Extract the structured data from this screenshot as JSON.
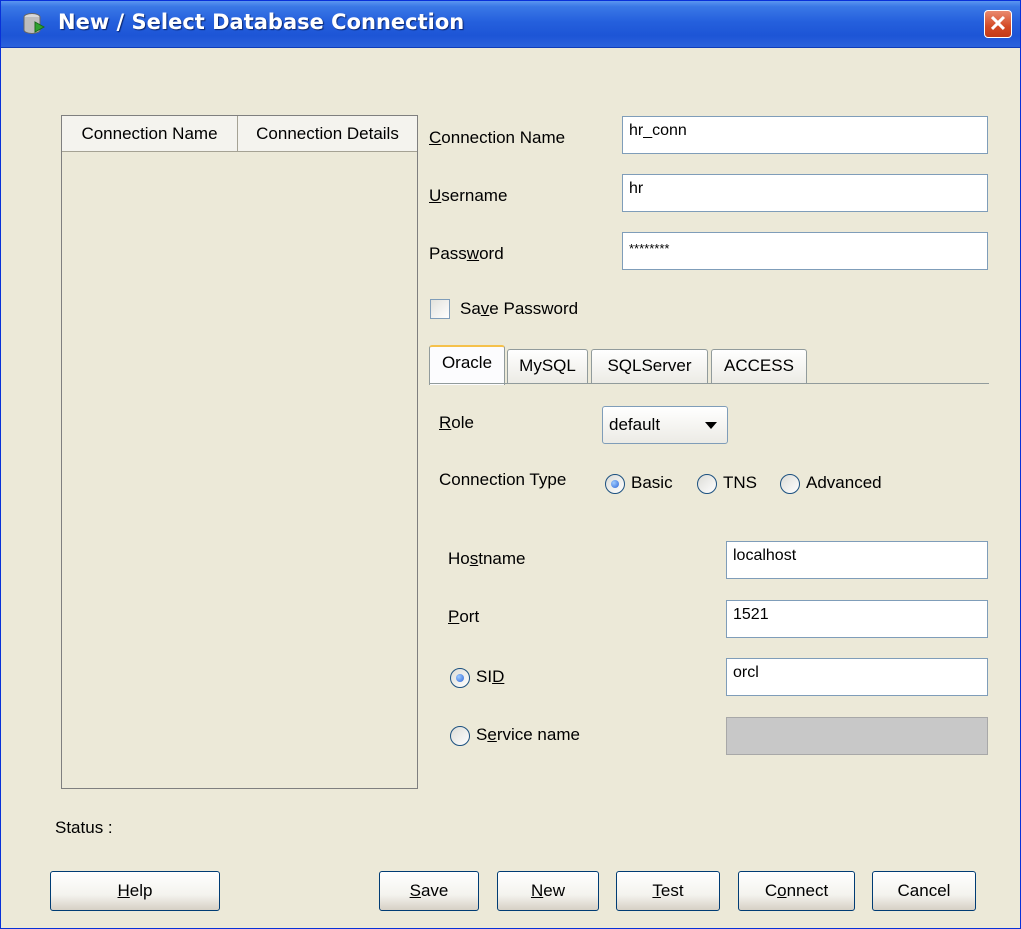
{
  "window": {
    "title": "New / Select Database Connection",
    "close_icon": "close-x-icon",
    "app_icon": "database-connection-icon"
  },
  "connections_table": {
    "columns": [
      "Connection Name",
      "Connection Details"
    ],
    "rows": []
  },
  "form": {
    "connection_name": {
      "label": "Connection Name",
      "value": "hr_conn"
    },
    "username": {
      "label": "Username",
      "value": "hr"
    },
    "password": {
      "label": "Password",
      "value": "********"
    },
    "save_password": {
      "label": "Save Password",
      "checked": false
    }
  },
  "tabs": [
    {
      "label": "Oracle",
      "active": true
    },
    {
      "label": "MySQL",
      "active": false
    },
    {
      "label": "SQLServer",
      "active": false
    },
    {
      "label": "ACCESS",
      "active": false
    }
  ],
  "oracle": {
    "role": {
      "label": "Role",
      "value": "default"
    },
    "connection_type": {
      "label": "Connection Type",
      "options": [
        "Basic",
        "TNS",
        "Advanced"
      ],
      "selected": "Basic"
    },
    "hostname": {
      "label": "Hostname",
      "value": "localhost"
    },
    "port": {
      "label": "Port",
      "value": "1521"
    },
    "sid": {
      "label": "SID",
      "value": "orcl",
      "selected": true
    },
    "service_name": {
      "label": "Service name",
      "value": "",
      "selected": false,
      "disabled": true
    }
  },
  "status": {
    "label": "Status :"
  },
  "buttons": {
    "help": "Help",
    "save": "Save",
    "new": "New",
    "test": "Test",
    "connect": "Connect",
    "cancel": "Cancel"
  }
}
